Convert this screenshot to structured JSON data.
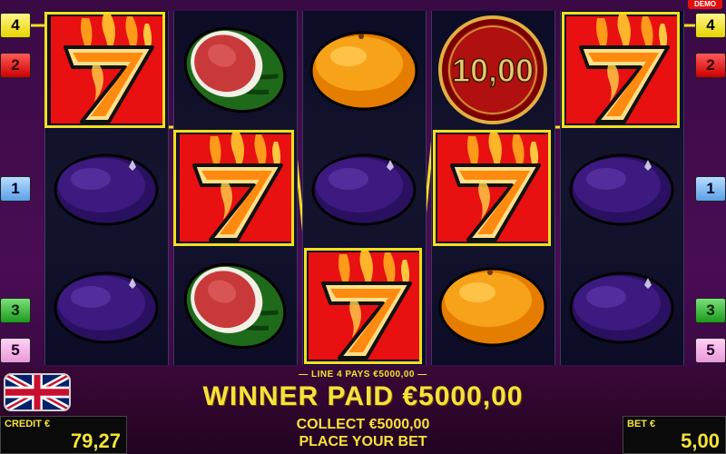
{
  "demo_label": "DEMO",
  "line_badges": {
    "left": [
      "4",
      "2",
      "1",
      "3",
      "5"
    ],
    "right": [
      "4",
      "2",
      "1",
      "3",
      "5"
    ]
  },
  "reels": [
    [
      "seven",
      "plum",
      "plum"
    ],
    [
      "watermelon",
      "seven",
      "watermelon"
    ],
    [
      "orange",
      "plum",
      "seven"
    ],
    [
      "coin",
      "seven",
      "orange"
    ],
    [
      "seven",
      "plum",
      "plum"
    ]
  ],
  "coin_value": "10,00",
  "winning_line": "4",
  "line_pays_text": "— LINE 4 PAYS €5000,00 —",
  "winner_text": "WINNER PAID €5000,00",
  "collect_text": "COLLECT €5000,00",
  "place_bet_text": "PLACE YOUR BET",
  "credit": {
    "label": "CREDIT €",
    "value": "79,27"
  },
  "bet": {
    "label": "BET €",
    "value": "5,00"
  },
  "language_flag": "uk-flag-icon",
  "colors": {
    "win_frame": "#f0e020",
    "text_gold": "#f6e23a",
    "demo_red": "#e01010"
  }
}
